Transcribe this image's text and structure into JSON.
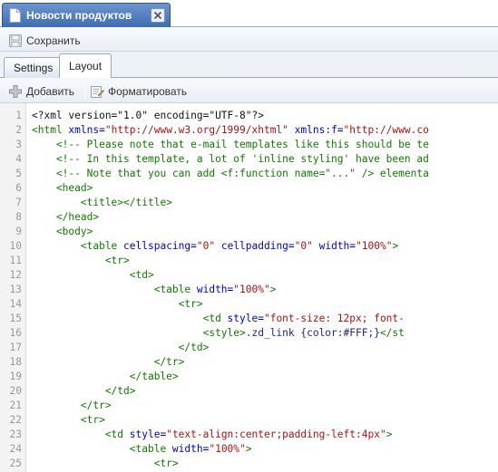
{
  "window": {
    "tab_title": "Новости продуктов"
  },
  "toolbar": {
    "save_label": "Сохранить"
  },
  "tabs": [
    {
      "label": "Settings",
      "active": false
    },
    {
      "label": "Layout",
      "active": true
    }
  ],
  "toolbar2": {
    "add_label": "Добавить",
    "format_label": "Форматировать"
  },
  "colors": {
    "tab_active": "#3f6db1",
    "tag": "#117700",
    "attribute": "#0000cc",
    "string": "#aa1111"
  },
  "editor": {
    "lines": [
      {
        "n": "1",
        "tokens": [
          {
            "t": "tx",
            "v": "<?xml version=\"1.0\" encoding=\"UTF-8\"?>"
          }
        ]
      },
      {
        "n": "2",
        "tokens": [
          {
            "t": "tg",
            "v": "<html "
          },
          {
            "t": "at",
            "v": "xmlns="
          },
          {
            "t": "st",
            "v": "\"http://www.w3.org/1999/xhtml\""
          },
          {
            "t": "at",
            "v": " xmlns:f="
          },
          {
            "t": "st",
            "v": "\"http://www.co"
          }
        ]
      },
      {
        "n": "3",
        "tokens": [
          {
            "t": "cm",
            "v": "    <!-- Please note that e-mail templates like this should be te"
          }
        ]
      },
      {
        "n": "4",
        "tokens": [
          {
            "t": "cm",
            "v": "    <!-- In this template, a lot of 'inline styling' have been ad"
          }
        ]
      },
      {
        "n": "5",
        "tokens": [
          {
            "t": "cm",
            "v": "    <!-- Note that you can add <f:function name=\"...\" /> elementa"
          }
        ]
      },
      {
        "n": "6",
        "tokens": [
          {
            "t": "tg",
            "v": "    <head>"
          }
        ]
      },
      {
        "n": "7",
        "tokens": [
          {
            "t": "tg",
            "v": "        <title></title>"
          }
        ]
      },
      {
        "n": "8",
        "tokens": [
          {
            "t": "tg",
            "v": "    </head>"
          }
        ]
      },
      {
        "n": "9",
        "tokens": [
          {
            "t": "tg",
            "v": "    <body>"
          }
        ]
      },
      {
        "n": "10",
        "tokens": [
          {
            "t": "tg",
            "v": "        <table "
          },
          {
            "t": "at",
            "v": "cellspacing="
          },
          {
            "t": "st",
            "v": "\"0\""
          },
          {
            "t": "at",
            "v": " cellpadding="
          },
          {
            "t": "st",
            "v": "\"0\""
          },
          {
            "t": "at",
            "v": " width="
          },
          {
            "t": "st",
            "v": "\"100%\""
          },
          {
            "t": "tg",
            "v": ">"
          }
        ]
      },
      {
        "n": "11",
        "tokens": [
          {
            "t": "tg",
            "v": "            <tr>"
          }
        ]
      },
      {
        "n": "12",
        "tokens": [
          {
            "t": "tg",
            "v": "                <td>"
          }
        ]
      },
      {
        "n": "13",
        "tokens": [
          {
            "t": "tg",
            "v": "                    <table "
          },
          {
            "t": "at",
            "v": "width="
          },
          {
            "t": "st",
            "v": "\"100%\""
          },
          {
            "t": "tg",
            "v": ">"
          }
        ]
      },
      {
        "n": "14",
        "tokens": [
          {
            "t": "tg",
            "v": "                        <tr>"
          }
        ]
      },
      {
        "n": "15",
        "tokens": [
          {
            "t": "tg",
            "v": "                            <td "
          },
          {
            "t": "at",
            "v": "style="
          },
          {
            "t": "st",
            "v": "\"font-size: 12px; font-"
          }
        ]
      },
      {
        "n": "16",
        "tokens": [
          {
            "t": "tg",
            "v": "                            <style>"
          },
          {
            "t": "cs",
            "v": ".zd_link {color:#FFF;}"
          },
          {
            "t": "tg",
            "v": "</st"
          }
        ]
      },
      {
        "n": "17",
        "tokens": [
          {
            "t": "tg",
            "v": "                        </td>"
          }
        ]
      },
      {
        "n": "18",
        "tokens": [
          {
            "t": "tg",
            "v": "                    </tr>"
          }
        ]
      },
      {
        "n": "19",
        "tokens": [
          {
            "t": "tg",
            "v": "                </table>"
          }
        ]
      },
      {
        "n": "20",
        "tokens": [
          {
            "t": "tg",
            "v": "            </td>"
          }
        ]
      },
      {
        "n": "21",
        "tokens": [
          {
            "t": "tg",
            "v": "        </tr>"
          }
        ]
      },
      {
        "n": "22",
        "tokens": [
          {
            "t": "tg",
            "v": "        <tr>"
          }
        ]
      },
      {
        "n": "23",
        "tokens": [
          {
            "t": "tg",
            "v": "            <td "
          },
          {
            "t": "at",
            "v": "style="
          },
          {
            "t": "st",
            "v": "\"text-align:center;padding-left:4px\""
          },
          {
            "t": "tg",
            "v": ">"
          }
        ]
      },
      {
        "n": "24",
        "tokens": [
          {
            "t": "tg",
            "v": "                <table "
          },
          {
            "t": "at",
            "v": "width="
          },
          {
            "t": "st",
            "v": "\"100%\""
          },
          {
            "t": "tg",
            "v": ">"
          }
        ]
      },
      {
        "n": "25",
        "tokens": [
          {
            "t": "tg",
            "v": "                    <tr>"
          }
        ]
      }
    ]
  }
}
